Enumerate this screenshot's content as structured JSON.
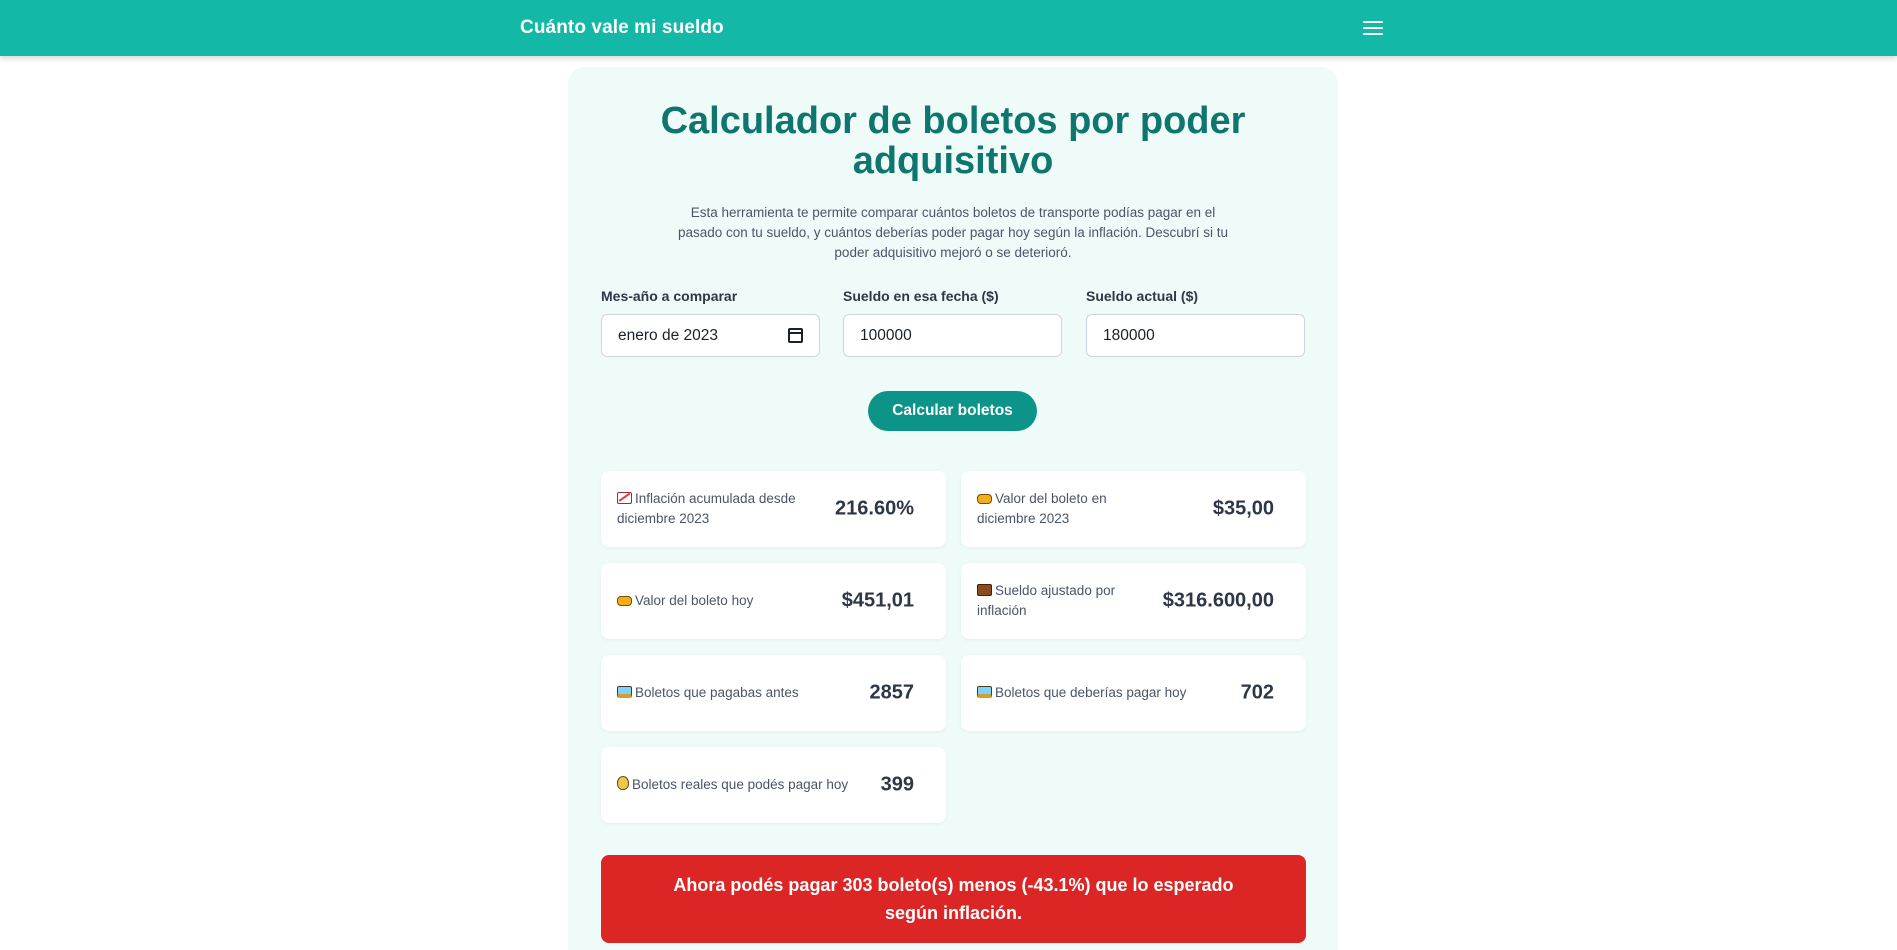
{
  "app": {
    "brand": "Cuánto vale mi sueldo"
  },
  "calculator": {
    "title": "Calculador de boletos por poder adquisitivo",
    "description": "Esta herramienta te permite comparar cuántos boletos de transporte podías pagar en el pasado con tu sueldo, y cuántos deberías poder pagar hoy según la inflación. Descubrí si tu poder adquisitivo mejoró o se deterioró.",
    "fields": {
      "date": {
        "label": "Mes-año a comparar",
        "value": "enero de 2023"
      },
      "past_salary": {
        "label": "Sueldo en esa fecha ($)",
        "value": "100000"
      },
      "current_salary": {
        "label": "Sueldo actual ($)",
        "value": "180000"
      }
    },
    "button_label": "Calcular boletos"
  },
  "results": {
    "inflation": {
      "icon": "chart-icon",
      "label": "Inflación acumulada desde diciembre 2023",
      "value": "216.60%"
    },
    "ticket_then": {
      "icon": "ticket-icon",
      "label": "Valor del boleto en diciembre 2023",
      "value": "$35,00"
    },
    "ticket_now": {
      "icon": "ticket-icon",
      "label": "Valor del boleto hoy",
      "value": "$451,01"
    },
    "adjusted_salary": {
      "icon": "briefcase-icon",
      "label": "Sueldo ajustado por inflación",
      "value": "$316.600,00"
    },
    "tickets_before": {
      "icon": "bus-icon",
      "label": "Boletos que pagabas antes",
      "value": "2857"
    },
    "tickets_should": {
      "icon": "bus-icon",
      "label": "Boletos que deberías pagar hoy",
      "value": "702"
    },
    "tickets_real": {
      "icon": "money-bag-icon",
      "label": "Boletos reales que podés pagar hoy",
      "value": "399"
    }
  },
  "alert": {
    "text": "Ahora podés pagar 303 boleto(s) menos (-43.1%) que lo esperado según inflación.",
    "color": "#dc2626"
  },
  "colors": {
    "header": "#14b8a6",
    "accent": "#0d9488",
    "title": "#0f766e"
  }
}
